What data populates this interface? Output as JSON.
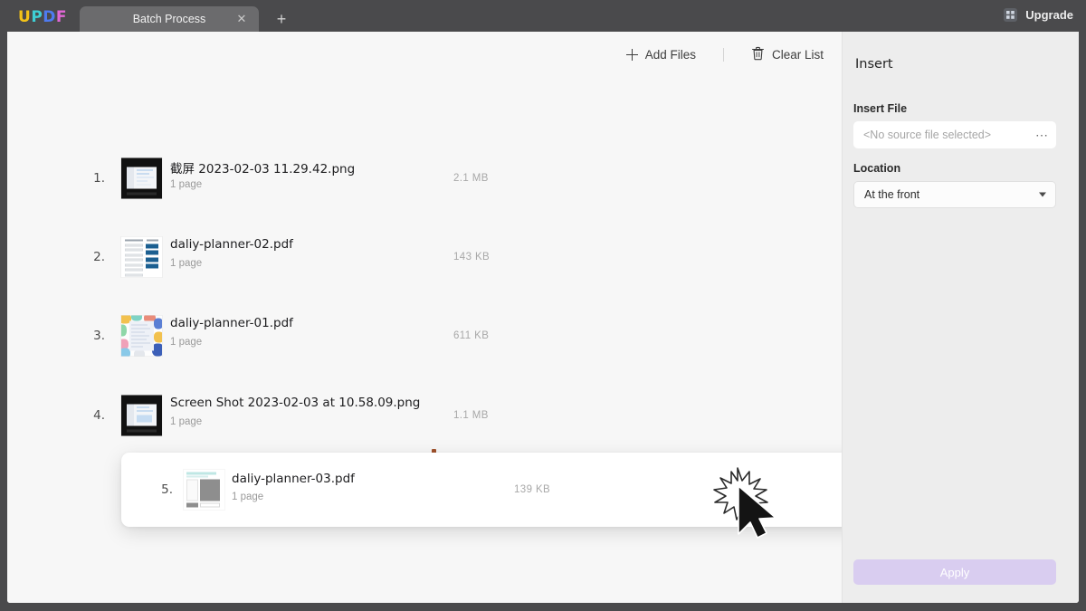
{
  "window": {
    "brand": "UPDF",
    "brand_letters": [
      {
        "ch": "U",
        "color": "#f3c318"
      },
      {
        "ch": "P",
        "color": "#3ecfd6"
      },
      {
        "ch": "D",
        "color": "#4f7bf0"
      },
      {
        "ch": "F",
        "color": "#e167d6"
      }
    ],
    "tab_label": "Batch Process",
    "tab_close_icon": "close-icon",
    "new_tab_icon": "plus-icon",
    "upgrade_label": "Upgrade",
    "upgrade_icon": "diamond-icon"
  },
  "toolbar": {
    "add_files_label": "Add Files",
    "add_files_icon": "plus-icon",
    "clear_list_label": "Clear List",
    "clear_list_icon": "trash-icon"
  },
  "file_list": {
    "items": [
      {
        "index": "1.",
        "name": "截屏 2023-02-03 11.29.42.png",
        "pages": "1 page",
        "size": "2.1 MB",
        "thumb": "dark-screenshot"
      },
      {
        "index": "2.",
        "name": "daliy-planner-02.pdf",
        "pages": "1 page",
        "size": "143 KB",
        "thumb": "blue-planner"
      },
      {
        "index": "3.",
        "name": "daliy-planner-01.pdf",
        "pages": "1 page",
        "size": "611 KB",
        "thumb": "colorful-planner"
      },
      {
        "index": "4.",
        "name": "Screen Shot 2023-02-03 at 10.58.09.png",
        "pages": "1 page",
        "size": "1.1 MB",
        "thumb": "dark-screenshot"
      }
    ],
    "dragged_item": {
      "index": "5.",
      "name": "daliy-planner-03.pdf",
      "pages": "1 page",
      "size": "139 KB",
      "thumb": "gray-planner"
    }
  },
  "right_panel": {
    "title": "Insert",
    "insert_file_label": "Insert File",
    "insert_file_value": "<No source file selected>",
    "insert_file_browse_icon": "ellipsis-icon",
    "location_label": "Location",
    "location_value": "At the front",
    "location_caret_icon": "chevron-down-icon",
    "apply_label": "Apply"
  },
  "colors": {
    "titlebar": "#4a4a4c",
    "tab_active": "#6b6b6d",
    "content_bg": "#f7f7f7",
    "panel_bg": "#ededed",
    "apply_disabled": "#d9cdf0",
    "drop_marker": "#a0522d"
  },
  "cursor": {
    "icon": "arrow-cursor-with-click-burst"
  }
}
